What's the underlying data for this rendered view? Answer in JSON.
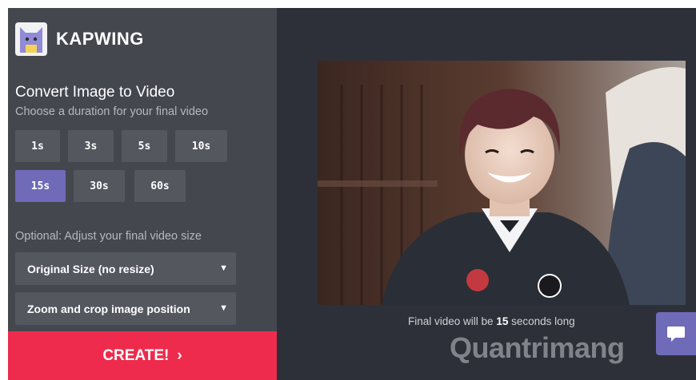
{
  "app": {
    "brand": "KAPWING"
  },
  "panel": {
    "title": "Convert Image to Video",
    "subtitle": "Choose a duration for your final video",
    "durations": [
      {
        "label": "1s",
        "selected": false
      },
      {
        "label": "3s",
        "selected": false
      },
      {
        "label": "5s",
        "selected": false
      },
      {
        "label": "10s",
        "selected": false
      },
      {
        "label": "15s",
        "selected": true
      },
      {
        "label": "30s",
        "selected": false
      },
      {
        "label": "60s",
        "selected": false
      }
    ],
    "size_label": "Optional: Adjust your final video size",
    "size_select": "Original Size (no resize)",
    "position_select": "Zoom and crop image position",
    "create_label": "CREATE!",
    "create_chevron": "›"
  },
  "preview": {
    "caption_prefix": "Final video will be",
    "duration_value": "15",
    "caption_suffix": "seconds long"
  },
  "watermark": "Quantrimang",
  "icons": {
    "logo": "kapwing-cat-logo",
    "chat": "chat-bubble-icon",
    "caret": "triangle-down-icon"
  },
  "colors": {
    "sidebar": "#45474f",
    "background": "#2e3039",
    "button": "#55575f",
    "accent": "#6f6bb8",
    "create": "#ee2b4c"
  }
}
